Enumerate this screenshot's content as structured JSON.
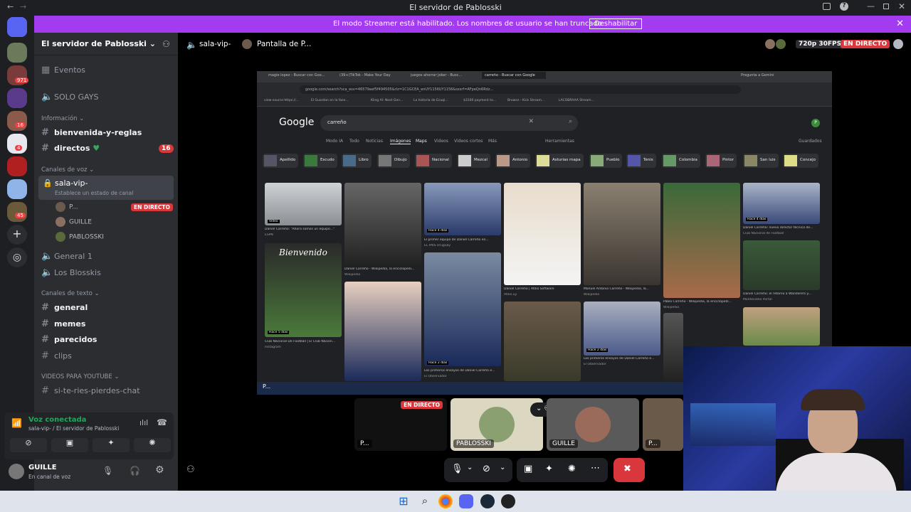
{
  "window": {
    "title": "El servidor de Pablosski"
  },
  "banner": {
    "message": "El modo Streamer está habilitado. Los nombres de usuario se han truncado.",
    "button": "Deshabilitar"
  },
  "rail": {
    "badges": [
      "971",
      "16",
      "4",
      "45"
    ]
  },
  "server": {
    "name": "El servidor de Pablosski"
  },
  "sidebar": {
    "events": "Eventos",
    "solo": "SOLO GAYS",
    "info_category": "Información",
    "info_channels": [
      "bienvenida-y-reglas",
      "directos"
    ],
    "directos_badge": "16",
    "voice_category": "Canales de voz",
    "active_voice": "sala-vip-",
    "active_voice_status": "Establece un estado de canal",
    "voice_users": [
      "P...",
      "GUILLE",
      "PABLOSSKI"
    ],
    "live_label": "EN DIRECTO",
    "other_voice": [
      "General 1",
      "Los Blosskis"
    ],
    "text_category": "Canales de texto",
    "text_channels": [
      "general",
      "memes",
      "parecidos",
      "clips"
    ],
    "yt_category": "VIDEOS PARA YOUTUBE",
    "yt_channels": [
      "si-te-ries-pierdes-chat"
    ]
  },
  "voice_panel": {
    "status": "Voz conectada",
    "channel": "sala-vip- / El servidor de Pablosski"
  },
  "user_panel": {
    "name": "GUILLE",
    "status": "En canal de voz"
  },
  "topbar": {
    "channel": "sala-vip-",
    "screen": "Pantalla de P...",
    "quality": "720p 30FPS",
    "live": "EN DIRECTO"
  },
  "browser": {
    "tabs": [
      "magie lopez - Buscar con Goo...",
      "(39+)TikTok - Make Your Day",
      "juegos ahorrar joker - Busc...",
      "carreño - Buscar con Google"
    ],
    "gemini": "Pregunta a Gemini",
    "url": "google.com/search?sca_esv=46579aef5f494505&rlz=1C1GCEA_enUY1156UY1156&sxsrf=AFpeQn6Rdz...",
    "bookmarks": [
      "view-source:https://...",
      "El Guardan en la fase...",
      "Kling AI: Next Gen...",
      "La historia de Ecuqi...",
      "$3100 payment to...",
      "Browse - Kick Stream...",
      "LACOBRAAA Stream..."
    ],
    "logo": "Google",
    "query": "carreño",
    "tabs_search": [
      "Modo IA",
      "Todo",
      "Noticias",
      "Imágenes",
      "Maps",
      "Videos",
      "Videos cortos",
      "Más",
      "Herramientas",
      "Guardados"
    ],
    "chips": [
      "Apellido",
      "Escudo",
      "Libro",
      "Dibujo",
      "Nacional",
      "Mezcal",
      "Antonio",
      "Asturias mapa",
      "Pueblo",
      "Tenis",
      "Colombia",
      "Pintor",
      "San luis",
      "Concejo"
    ],
    "captions": [
      "Daniel Carreño: \"Ahora somos un equipo...\"",
      "Daniel Carreño - Wikipedia, la enciclopedi...",
      "El primer equipo de Daniel Carreño en...",
      "Daniel Carreño | Atilio Software",
      "Manuel Antonio Carreño - Wikipedia, la...",
      "Pablo Carreño - Wikipedia, la enciclopedi...",
      "Daniel Carreño: nuevo director técnico de...",
      "Club Nacional De Football | El Club Nacion...",
      "Los primeros ensayos de Daniel Carreño e...",
      "Los primeros ensayos de Daniel Carreño e...",
      "Daniel Carreño: el retorno a Wanderers y..."
    ],
    "sources": [
      "ESPN",
      "Wikipedia",
      "EL PAIS Uruguay",
      "Atilio.uy",
      "Wikipedia",
      "Wikipedia",
      "Club Nacional de Football",
      "Instagram",
      "El Observador",
      "El Observador",
      "Montevideo Portal"
    ],
    "biembenido": "Bienvenido",
    "time_tags": [
      "Video",
      "Hace 4 días",
      "Hace 4 días",
      "Hace 5 días",
      "Hace 2 días",
      "Hace 2 días"
    ]
  },
  "participants": [
    {
      "name": "P...",
      "live": "EN DIRECTO"
    },
    {
      "name": "PABLOSSKI"
    },
    {
      "name": "GUILLE"
    },
    {
      "name": "P..."
    }
  ],
  "colors": {
    "accent": "#a33cf0",
    "live": "#da373c",
    "sidebar": "#2b2d31",
    "rail": "#1e1f22"
  }
}
